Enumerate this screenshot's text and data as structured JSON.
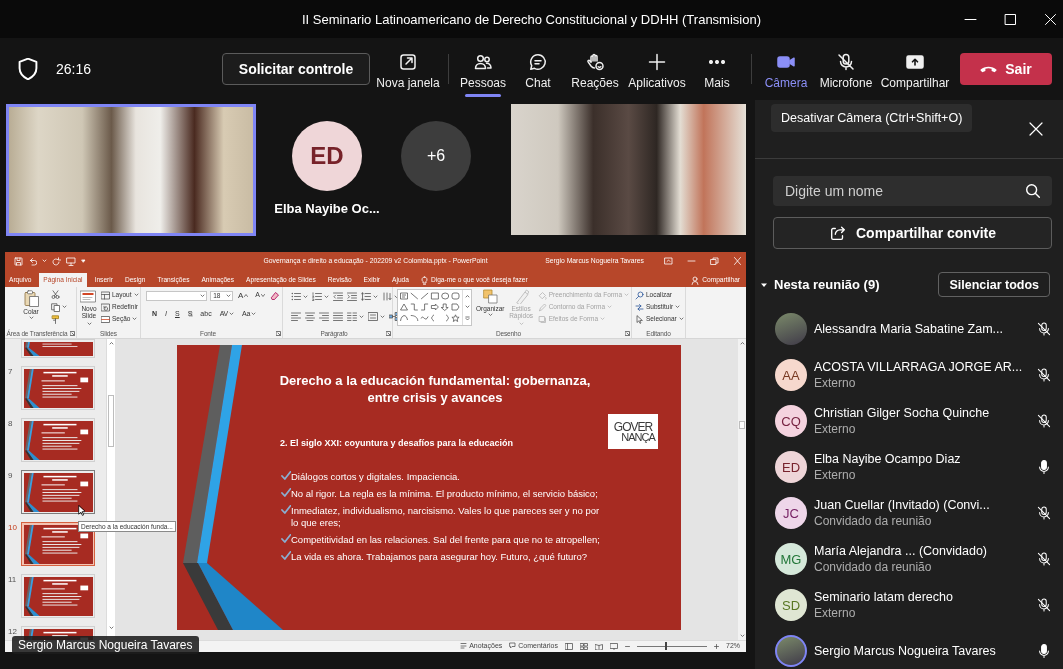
{
  "window": {
    "title": "II Seminario Latinoamericano de Derecho Constitucional y DDHH (Transmision)"
  },
  "meeting_bar": {
    "elapsed": "26:16",
    "request_control": "Solicitar controle",
    "new_window": "Nova janela",
    "controls": [
      {
        "kind": "people",
        "label": "Pessoas",
        "selected": true
      },
      {
        "kind": "chat",
        "label": "Chat",
        "selected": false
      },
      {
        "kind": "reactions",
        "label": "Reações",
        "selected": false
      },
      {
        "kind": "apps",
        "label": "Aplicativos",
        "selected": false
      },
      {
        "kind": "more",
        "label": "Mais",
        "selected": false
      }
    ],
    "devices": [
      {
        "kind": "camera",
        "label": "Câmera",
        "on": true
      },
      {
        "kind": "mic",
        "label": "Microfone",
        "on": false
      },
      {
        "kind": "share",
        "label": "Compartilhar"
      }
    ],
    "leave": "Sair"
  },
  "tooltip": "Desativar Câmera (Ctrl+Shift+O)",
  "stage": {
    "tiles": [
      {
        "kind": "video",
        "speaking": true
      },
      {
        "kind": "avatar",
        "initials": "ED",
        "name": "Elba Nayibe Oc...",
        "color": "#efd6d8"
      },
      {
        "kind": "overflow",
        "count": "+6"
      },
      {
        "kind": "video",
        "speaking": false
      }
    ],
    "shared_screen": {
      "presenter": "Sergio Marcus Nogueira Tavares",
      "title": "Governança e direito a educação - 202209 v2 Colombia.pptx - PowerPoint",
      "user": "Sergio Marcus Nogueira Tavares",
      "tabs": [
        {
          "label": "Arquivo",
          "selected": false
        },
        {
          "label": "Página Inicial",
          "selected": true
        },
        {
          "label": "Inserir",
          "selected": false
        },
        {
          "label": "Design",
          "selected": false
        },
        {
          "label": "Transições",
          "selected": false
        },
        {
          "label": "Animações",
          "selected": false
        },
        {
          "label": "Apresentação de Slides",
          "selected": false
        },
        {
          "label": "Revisão",
          "selected": false
        },
        {
          "label": "Exibir",
          "selected": false
        },
        {
          "label": "Ajuda",
          "selected": false
        }
      ],
      "tell_me": "Diga-me o que você deseja fazer",
      "share": "Compartilhar",
      "ribbon": [
        {
          "kind": "clipboard",
          "label": "Área de Transferência",
          "paste": "Colar"
        },
        {
          "kind": "slides",
          "label": "Slides",
          "new_slide": "Novo Slide",
          "commands": [
            "Layout",
            "Redefinir",
            "Seção"
          ]
        },
        {
          "kind": "font",
          "label": "Fonte",
          "size": "18",
          "size_buttons": [
            "A",
            "A"
          ],
          "format_buttons": [
            "N",
            "I",
            "S",
            "S",
            "abc",
            "AV",
            "Aa"
          ]
        },
        {
          "kind": "paragraph",
          "label": "Parágrafo"
        },
        {
          "kind": "drawing",
          "label": "Desenho",
          "arrange": "Organizar",
          "quick_styles": {
            "label": "Estilos Rápidos",
            "disabled": true
          },
          "commands": [
            {
              "label": "Preenchimento da Forma",
              "disabled": true
            },
            {
              "label": "Contorno da Forma",
              "disabled": true
            },
            {
              "label": "Efeitos de Forma",
              "disabled": true
            }
          ]
        },
        {
          "kind": "editing",
          "label": "Editando",
          "commands": [
            "Localizar",
            "Substituir",
            "Selecionar"
          ]
        }
      ],
      "thumbnails": [
        {
          "selected": false,
          "hovered": false
        },
        {
          "number": "7",
          "selected": false,
          "hovered": false
        },
        {
          "number": "8",
          "selected": false,
          "hovered": false
        },
        {
          "number": "9",
          "selected": false,
          "hovered": true
        },
        {
          "number": "10",
          "selected": true,
          "hovered": false
        },
        {
          "number": "11",
          "selected": false,
          "hovered": false
        },
        {
          "number": "12",
          "selected": false,
          "hovered": false
        }
      ],
      "thumbnail_tooltip": "Derecho a la educación funda...",
      "slide": {
        "title": "Derecho a la educación fundamental: gobernanza, entre crisis y avances",
        "logo": [
          "GOVER",
          "NANÇA"
        ],
        "subtitle": "2. El siglo XXI: coyuntura y desafíos para la educación",
        "bullets": [
          "Diálogos cortos y digitales. Impaciencia.",
          "No al rigor. La regla es la mínima. El producto mínimo, el servicio básico;",
          "Inmediatez, individualismo, narcisismo. Vales lo que pareces ser y no por lo que eres;",
          "Competitividad en las relaciones. Sal del frente para que no te atropellen;",
          "La vida es ahora. Trabajamos para asegurar hoy. Futuro, ¿qué futuro?"
        ]
      },
      "status_bar": {
        "notes": "Anotações",
        "comments": "Comentários",
        "zoom": "72%",
        "level": 0.42
      }
    }
  },
  "people_panel": {
    "search": {
      "placeholder": "Digite um nome"
    },
    "invite": "Compartilhar convite",
    "section": {
      "label": "Nesta reunião (9)",
      "expanded": true
    },
    "mute_all": "Silenciar todos",
    "participants": [
      {
        "kind": "photo",
        "name": "Alessandra Maria Sabatine Zam...",
        "muted": true,
        "speaking": false
      },
      {
        "kind": "initials",
        "initials": "AA",
        "color": "#f6d8cd",
        "name": "ACOSTA VILLARRAGA JORGE AR...",
        "role": "Externo",
        "muted": true,
        "speaking": false
      },
      {
        "kind": "initials",
        "initials": "CQ",
        "color": "#f4d3df",
        "name": "Christian Gilger Socha Quinche",
        "role": "Externo",
        "muted": true,
        "speaking": false
      },
      {
        "kind": "initials",
        "initials": "ED",
        "color": "#eed5d8",
        "name": "Elba Nayibe Ocampo Diaz",
        "role": "Externo",
        "muted": false,
        "speaking": false
      },
      {
        "kind": "initials",
        "initials": "JC",
        "color": "#eed6e9",
        "name": "Juan Cuellar (Invitado) (Convi...",
        "role": "Convidado da reunião",
        "muted": true,
        "speaking": false
      },
      {
        "kind": "initials",
        "initials": "MG",
        "color": "#d5e8da",
        "name": "María Alejandra ... (Convidado)",
        "role": "Convidado da reunião",
        "muted": true,
        "speaking": false
      },
      {
        "kind": "initials",
        "initials": "SD",
        "color": "#dfe6d3",
        "name": "Seminario latam derecho",
        "role": "Externo",
        "muted": true,
        "speaking": false
      },
      {
        "kind": "photo",
        "name": "Sergio Marcus Nogueira Tavares",
        "muted": false,
        "speaking": true
      }
    ]
  }
}
